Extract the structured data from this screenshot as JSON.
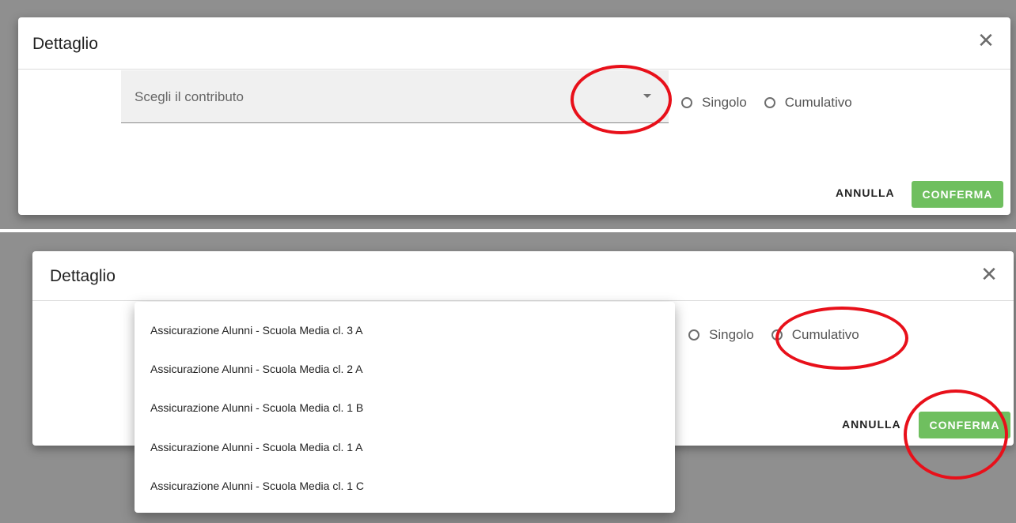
{
  "top_dialog": {
    "title": "Dettaglio",
    "close_glyph": "✕",
    "select_placeholder": "Scegli il contributo",
    "radio_options": [
      "Singolo",
      "Cumulativo"
    ],
    "cancel_label": "ANNULLA",
    "confirm_label": "CONFERMA"
  },
  "bottom_dialog": {
    "title": "Dettaglio",
    "close_glyph": "✕",
    "radio_options": [
      "Singolo",
      "Cumulativo"
    ],
    "cancel_label": "ANNULLA",
    "confirm_label": "CONFERMA"
  },
  "dropdown": {
    "options": [
      "Assicurazione Alunni - Scuola Media cl. 3 A",
      "Assicurazione Alunni - Scuola Media cl. 2 A",
      "Assicurazione Alunni - Scuola Media cl. 1 B",
      "Assicurazione Alunni - Scuola Media cl. 1 A",
      "Assicurazione Alunni - Scuola Media cl. 1 C"
    ]
  },
  "colors": {
    "confirm_button": "#6fbf5f",
    "annotation": "#e8101a",
    "backdrop": "#8f8f8f"
  },
  "icons": {
    "close": "close-icon",
    "dropdown_caret": "caret-down-icon",
    "radio": "radio-unchecked-icon"
  }
}
